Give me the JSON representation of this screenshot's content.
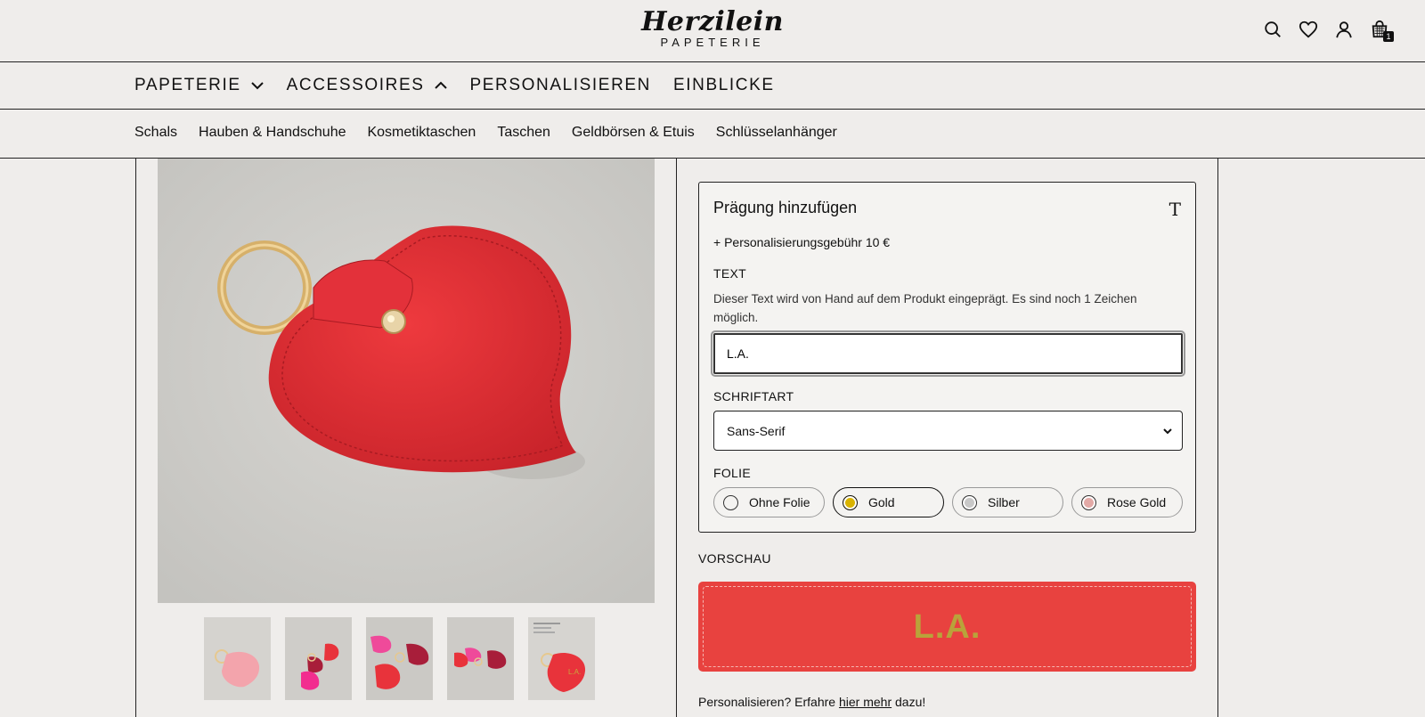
{
  "header": {
    "logo_script": "Herzilein",
    "logo_sub": "PAPETERIE",
    "cart_count": "1"
  },
  "mainnav": [
    {
      "label": "PAPETERIE",
      "chevron": "down"
    },
    {
      "label": "ACCESSOIRES",
      "chevron": "up"
    },
    {
      "label": "PERSONALISIEREN"
    },
    {
      "label": "EINBLICKE"
    }
  ],
  "subnav": [
    "Schals",
    "Hauben & Handschuhe",
    "Kosmetiktaschen",
    "Taschen",
    "Geldbörsen & Etuis",
    "Schlüsselanhänger"
  ],
  "personalize": {
    "title": "Prägung hinzufügen",
    "title_icon": "T",
    "fee_prefix": "+ Personalisierungsgebühr ",
    "fee_amount": "10 €",
    "text_label": "TEXT",
    "text_desc": "Dieser Text wird von Hand auf dem Produkt eingeprägt. Es sind noch 1 Zeichen möglich.",
    "text_value": "L.A.",
    "font_label": "SCHRIFTART",
    "font_value": "Sans-Serif",
    "foil_label": "FOLIE",
    "foils": [
      {
        "label": "Ohne Folie",
        "color": "#f4f3f1",
        "selected": false
      },
      {
        "label": "Gold",
        "color": "#d9b300",
        "selected": true
      },
      {
        "label": "Silber",
        "color": "#c8c8c8",
        "selected": false
      },
      {
        "label": "Rose Gold",
        "color": "#e3a9a6",
        "selected": false
      }
    ]
  },
  "preview": {
    "label": "VORSCHAU",
    "text": "L.A.",
    "leather_color": "#e8423f",
    "foil_color": "#b9a33a"
  },
  "more": {
    "prefix": "Personalisieren? Erfahre ",
    "link": "hier mehr",
    "suffix": " dazu!"
  }
}
